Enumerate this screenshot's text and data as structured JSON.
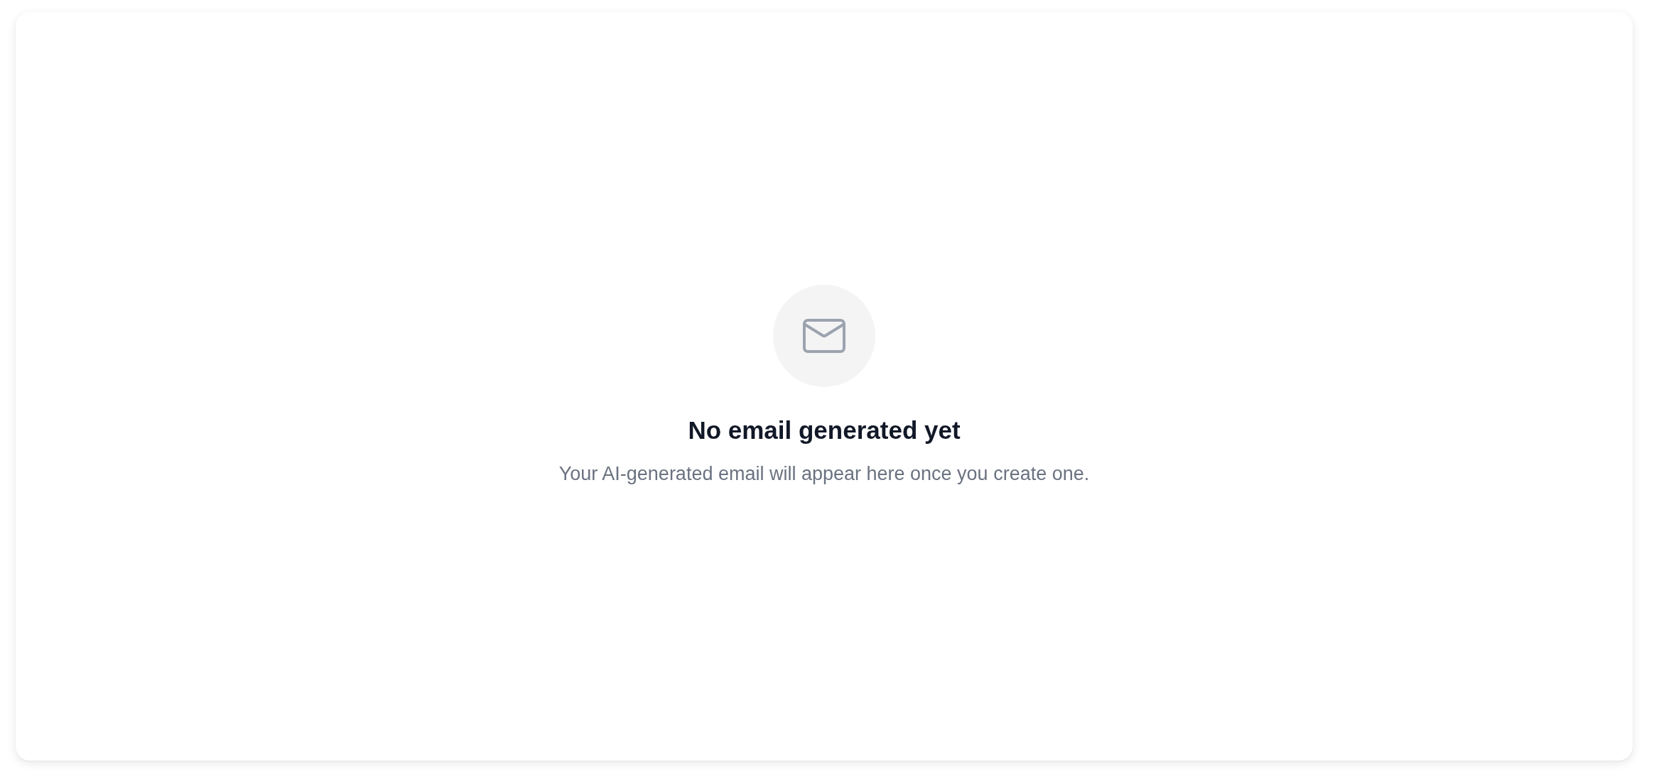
{
  "empty_state": {
    "title": "No email generated yet",
    "message": "Your AI-generated email will appear here once you create one."
  }
}
